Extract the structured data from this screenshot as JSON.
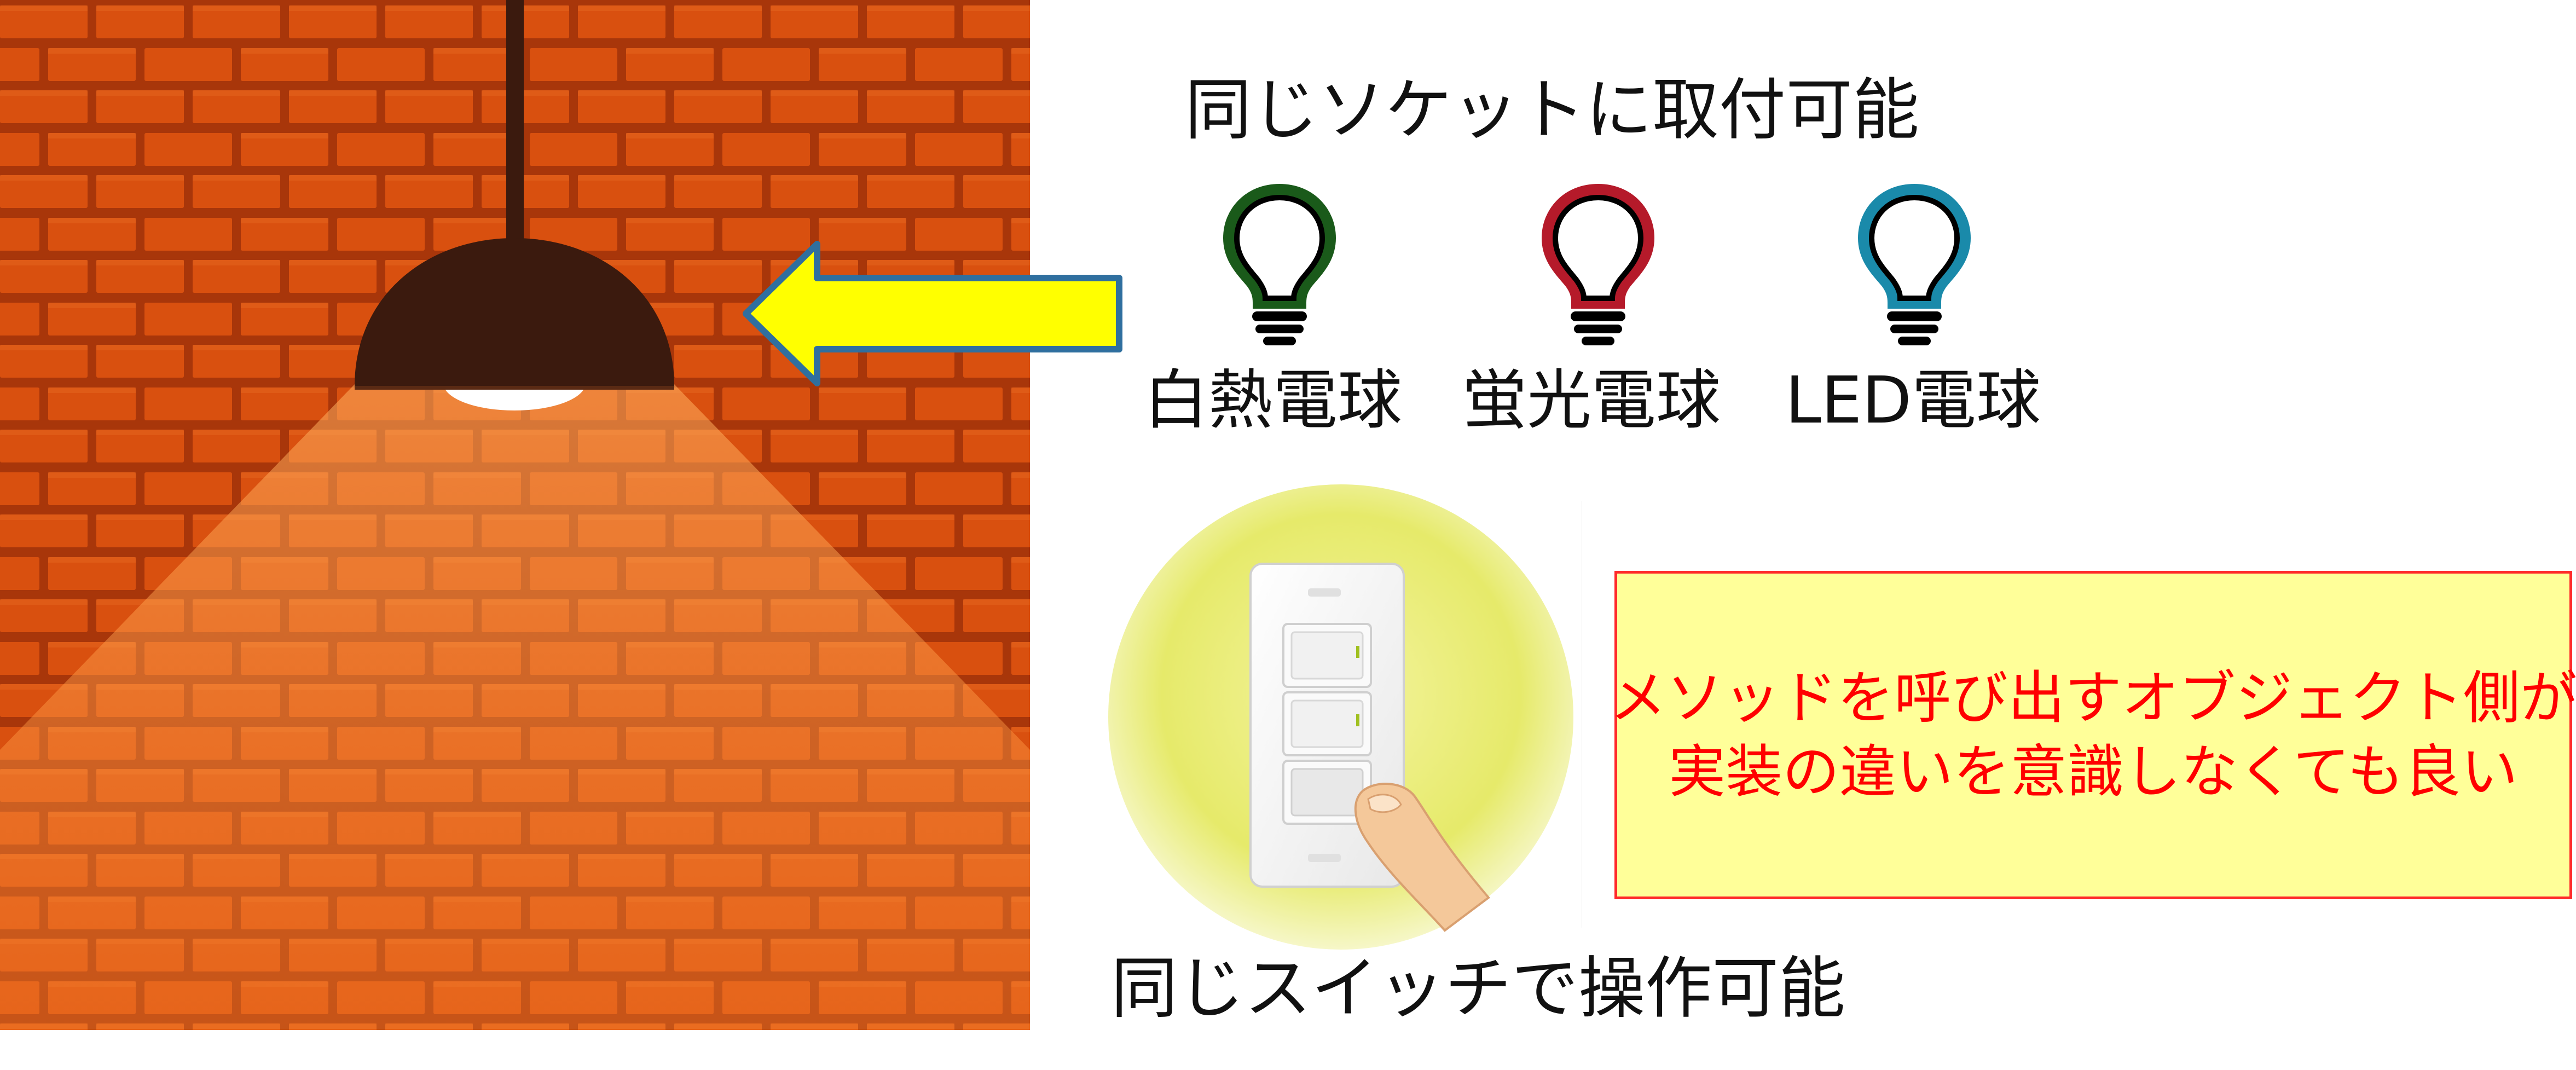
{
  "socket_heading": "同じソケットに取付可能",
  "bulbs": [
    {
      "label": "白熱電球",
      "color": "#1a5a1a",
      "icon": "lightbulb-icon"
    },
    {
      "label": "蛍光電球",
      "color": "#b51a2a",
      "icon": "lightbulb-icon"
    },
    {
      "label": "LED電球",
      "color": "#1a8aaa",
      "icon": "lightbulb-icon"
    }
  ],
  "switch_caption": "同じスイッチで操作可能",
  "note": {
    "lines": [
      "メソッドを呼び出すオブジェクト側が",
      "実装の違いを意識しなくても良い"
    ],
    "text_color": "#ff0000",
    "background": "#ffff99",
    "border_color": "#ff2a2a"
  },
  "colors": {
    "brick_wall": "#d94e10",
    "arrow_fill": "#ffff00",
    "arrow_stroke": "#2f6f9f",
    "lamp_shade": "#3b1a0e"
  },
  "icons": [
    "pendant-lamp-icon",
    "arrow-left-icon",
    "wall-switch-icon",
    "finger-icon"
  ]
}
